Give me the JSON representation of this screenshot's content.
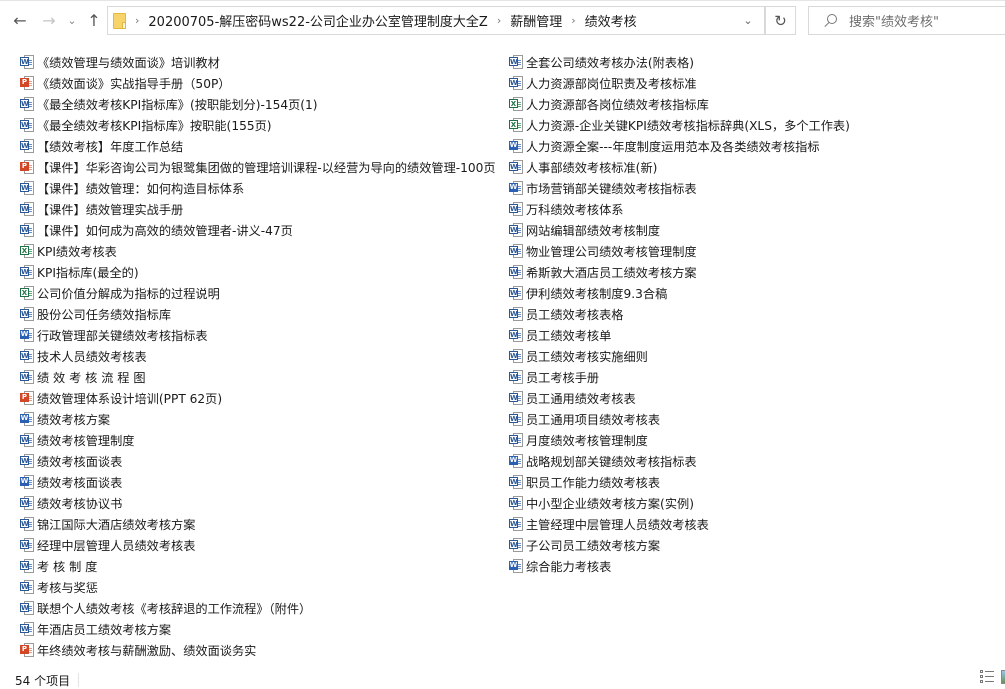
{
  "nav": {
    "back_icon": "arrow-left-icon",
    "forward_icon": "arrow-right-icon",
    "recent_icon": "chevron-down-icon",
    "up_icon": "arrow-up-icon",
    "back_glyph": "←",
    "forward_glyph": "→",
    "recent_glyph": "⌄",
    "up_glyph": "↑"
  },
  "address": {
    "breadcrumbs": [
      "20200705-解压密码ws22-公司企业办公室管理制度大全Z",
      "薪酬管理",
      "绩效考核"
    ],
    "separator": "›",
    "dropdown_glyph": "⌄",
    "refresh_glyph": "↻"
  },
  "search": {
    "placeholder": "搜索\"绩效考核\""
  },
  "files": {
    "left": [
      {
        "name": "《绩效管理与绩效面谈》培训教材",
        "type": "word"
      },
      {
        "name": "《绩效面谈》实战指导手册（50P）",
        "type": "ppt"
      },
      {
        "name": "《最全绩效考核KPI指标库》(按职能划分)-154页(1)",
        "type": "word"
      },
      {
        "name": "《最全绩效考核KPI指标库》按职能(155页)",
        "type": "word"
      },
      {
        "name": "【绩效考核】年度工作总结",
        "type": "word"
      },
      {
        "name": "【课件】华彩咨询公司为银鹭集团做的管理培训课程-以经营为导向的绩效管理-100页",
        "type": "ppt"
      },
      {
        "name": "【课件】绩效管理：如何构造目标体系",
        "type": "word"
      },
      {
        "name": "【课件】绩效管理实战手册",
        "type": "word"
      },
      {
        "name": "【课件】如何成为高效的绩效管理者-讲义-47页",
        "type": "word"
      },
      {
        "name": "KPI绩效考核表",
        "type": "excel"
      },
      {
        "name": "KPI指标库(最全的)",
        "type": "word"
      },
      {
        "name": "公司价值分解成为指标的过程说明",
        "type": "excel"
      },
      {
        "name": "股份公司任务绩效指标库",
        "type": "word"
      },
      {
        "name": "行政管理部关键绩效考核指标表",
        "type": "word-solid"
      },
      {
        "name": "技术人员绩效考核表",
        "type": "word"
      },
      {
        "name": "绩 效 考 核 流 程 图",
        "type": "word"
      },
      {
        "name": "绩效管理体系设计培训(PPT 62页)",
        "type": "ppt"
      },
      {
        "name": "绩效考核方案",
        "type": "word-solid"
      },
      {
        "name": "绩效考核管理制度",
        "type": "word"
      },
      {
        "name": "绩效考核面谈表",
        "type": "word"
      },
      {
        "name": "绩效考核面谈表",
        "type": "word-solid"
      },
      {
        "name": "绩效考核协议书",
        "type": "word"
      },
      {
        "name": "锦江国际大酒店绩效考核方案",
        "type": "word"
      },
      {
        "name": "经理中层管理人员绩效考核表",
        "type": "word"
      },
      {
        "name": "考 核 制 度",
        "type": "word"
      },
      {
        "name": "考核与奖惩",
        "type": "word"
      },
      {
        "name": "联想个人绩效考核《考核辞退的工作流程》（附件）",
        "type": "word"
      },
      {
        "name": "年酒店员工绩效考核方案",
        "type": "word"
      },
      {
        "name": "年终绩效考核与薪酬激励、绩效面谈务实",
        "type": "ppt"
      }
    ],
    "right": [
      {
        "name": "全套公司绩效考核办法(附表格)",
        "type": "word"
      },
      {
        "name": "人力资源部岗位职责及考核标准",
        "type": "word"
      },
      {
        "name": "人力资源部各岗位绩效考核指标库",
        "type": "excel"
      },
      {
        "name": "人力资源-企业关键KPI绩效考核指标辞典(XLS，多个工作表)",
        "type": "excel"
      },
      {
        "name": "人力资源全案---年度制度运用范本及各类绩效考核指标",
        "type": "word-solid"
      },
      {
        "name": "人事部绩效考核标准(新)",
        "type": "word"
      },
      {
        "name": "市场营销部关键绩效考核指标表",
        "type": "word-solid"
      },
      {
        "name": "万科绩效考核体系",
        "type": "word"
      },
      {
        "name": "网站编辑部绩效考核制度",
        "type": "word"
      },
      {
        "name": "物业管理公司绩效考核管理制度",
        "type": "word"
      },
      {
        "name": "希斯敦大酒店员工绩效考核方案",
        "type": "word"
      },
      {
        "name": "伊利绩效考核制度9.3合稿",
        "type": "word"
      },
      {
        "name": "员工绩效考核表格",
        "type": "word"
      },
      {
        "name": "员工绩效考核单",
        "type": "word"
      },
      {
        "name": "员工绩效考核实施细则",
        "type": "word"
      },
      {
        "name": "员工考核手册",
        "type": "word"
      },
      {
        "name": "员工通用绩效考核表",
        "type": "word"
      },
      {
        "name": "员工通用项目绩效考核表",
        "type": "word"
      },
      {
        "name": "月度绩效考核管理制度",
        "type": "word"
      },
      {
        "name": "战略规划部关键绩效考核指标表",
        "type": "word-solid"
      },
      {
        "name": "职员工作能力绩效考核表",
        "type": "word"
      },
      {
        "name": "中小型企业绩效考核方案(实例)",
        "type": "word"
      },
      {
        "name": "主管经理中层管理人员绩效考核表",
        "type": "word"
      },
      {
        "name": "子公司员工绩效考核方案",
        "type": "word"
      },
      {
        "name": "综合能力考核表",
        "type": "word-solid"
      }
    ]
  },
  "icon_badges": {
    "word": "W",
    "word-solid": "W",
    "ppt": "P",
    "excel": "X"
  },
  "status": {
    "item_count": "54 个项目"
  },
  "colors": {
    "word": "#2b5797",
    "ppt": "#d24726",
    "excel": "#1e7145",
    "folder": "#f7d46b"
  }
}
